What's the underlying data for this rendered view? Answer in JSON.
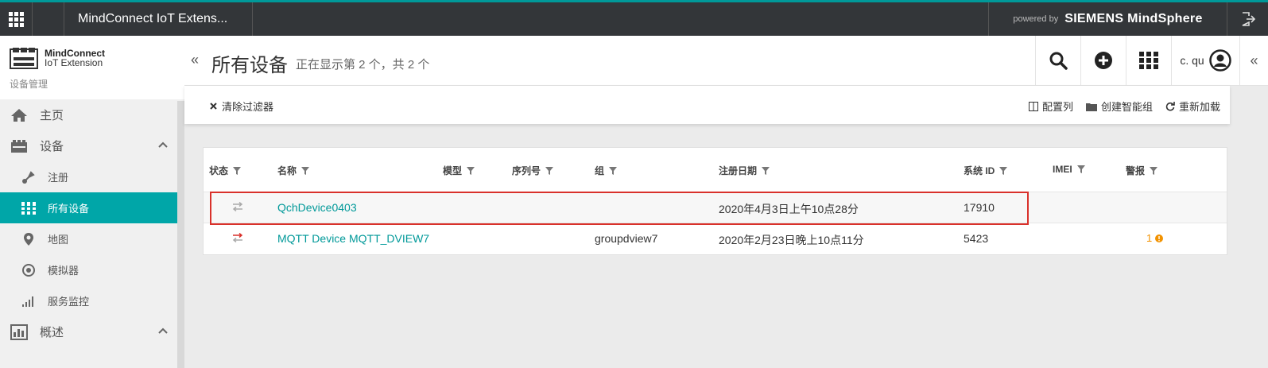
{
  "topbar": {
    "app_title": "MindConnect IoT Extens...",
    "powered_prefix": "powered by",
    "powered_brand": "SIEMENS MindSphere"
  },
  "sidebar": {
    "brand_line1": "MindConnect",
    "brand_line2": "IoT Extension",
    "section": "设备管理",
    "items": [
      {
        "label": "主页",
        "icon": "home-icon"
      },
      {
        "label": "设备",
        "icon": "devices-icon"
      },
      {
        "label": "注册",
        "icon": "register-icon"
      },
      {
        "label": "所有设备",
        "icon": "all-devices-icon"
      },
      {
        "label": "地图",
        "icon": "map-pin-icon"
      },
      {
        "label": "模拟器",
        "icon": "simulator-icon"
      },
      {
        "label": "服务监控",
        "icon": "signal-bars-icon"
      },
      {
        "label": "概述",
        "icon": "overview-icon"
      }
    ]
  },
  "header": {
    "title": "所有设备",
    "subtitle": "正在显示第 2 个，共 2 个",
    "user": "c. qu"
  },
  "toolbar": {
    "clear_filters": "清除过滤器",
    "configure_columns": "配置列",
    "create_smart_group": "创建智能组",
    "reload": "重新加载"
  },
  "table": {
    "columns": [
      "状态",
      "名称",
      "模型",
      "序列号",
      "组",
      "注册日期",
      "系统 ID",
      "IMEI",
      "警报"
    ],
    "rows": [
      {
        "name": "QchDevice0403",
        "group": "",
        "registered": "2020年4月3日上午10点28分",
        "system_id": "17910",
        "alarms": ""
      },
      {
        "name": "MQTT Device MQTT_DVIEW7",
        "group": "groupdview7",
        "registered": "2020年2月23日晚上10点11分",
        "system_id": "5423",
        "alarms": "1"
      }
    ]
  },
  "colors": {
    "accent": "#00a6a8",
    "topbar": "#333639",
    "highlight": "#d9312b",
    "alarm": "#f29200"
  }
}
